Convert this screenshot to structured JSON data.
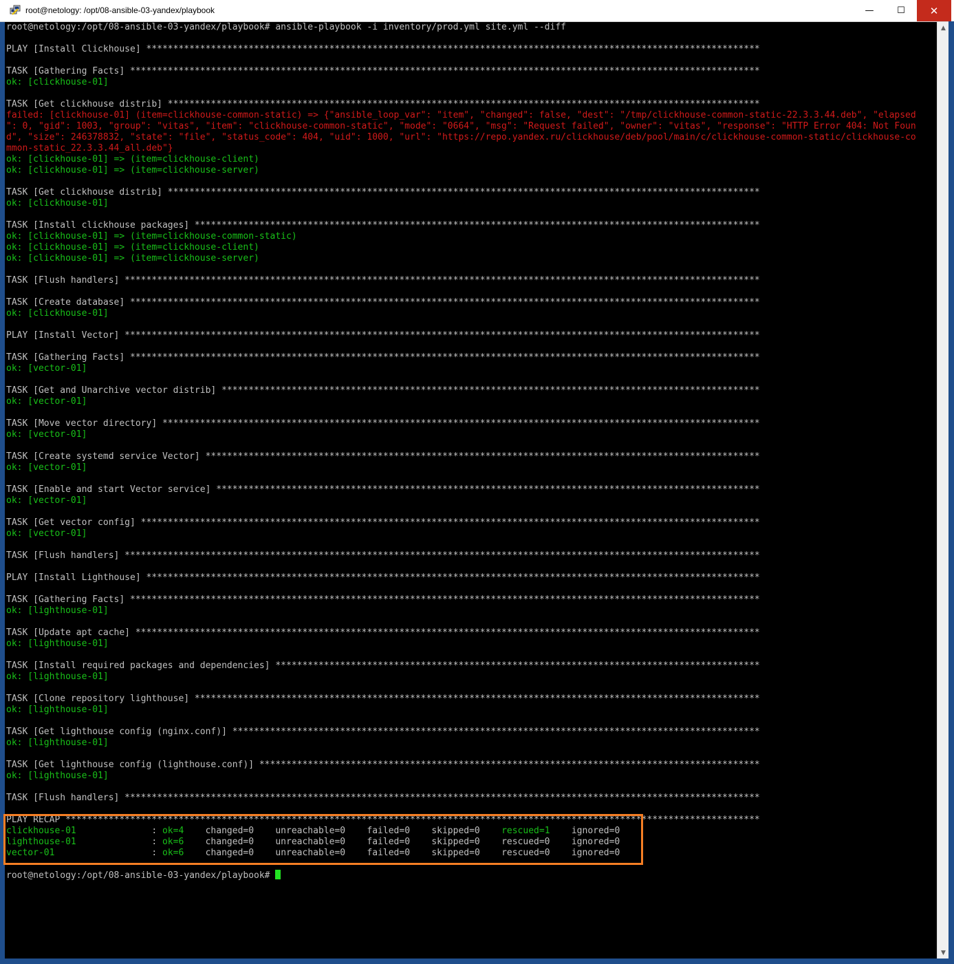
{
  "window": {
    "title": "root@netology: /opt/08-ansible-03-yandex/playbook",
    "minimize_glyph": "—",
    "maximize_glyph": "☐",
    "close_glyph": "✕"
  },
  "terminal": {
    "lines": [
      {
        "segments": [
          {
            "text": "root@netology:/opt/08-ansible-03-yandex/playbook# ansible-playbook -i inventory/prod.yml site.yml --diff",
            "color": "gray"
          }
        ]
      },
      {
        "segments": []
      },
      {
        "segments": [
          {
            "text": "PLAY [Install Clickhouse] ******************************************************************************************************************",
            "color": "gray"
          }
        ]
      },
      {
        "segments": []
      },
      {
        "segments": [
          {
            "text": "TASK [Gathering Facts] *********************************************************************************************************************",
            "color": "gray"
          }
        ]
      },
      {
        "segments": [
          {
            "text": "ok: [clickhouse-01]",
            "color": "green"
          }
        ]
      },
      {
        "segments": []
      },
      {
        "segments": [
          {
            "text": "TASK [Get clickhouse distrib] **************************************************************************************************************",
            "color": "gray"
          }
        ]
      },
      {
        "segments": [
          {
            "text": "failed: [clickhouse-01] (item=clickhouse-common-static) => {\"ansible_loop_var\": \"item\", \"changed\": false, \"dest\": \"/tmp/clickhouse-common-static-22.3.3.44.deb\", \"elapsed",
            "color": "red"
          }
        ]
      },
      {
        "segments": [
          {
            "text": "\": 0, \"gid\": 1003, \"group\": \"vitas\", \"item\": \"clickhouse-common-static\", \"mode\": \"0664\", \"msg\": \"Request failed\", \"owner\": \"vitas\", \"response\": \"HTTP Error 404: Not Foun",
            "color": "red"
          }
        ]
      },
      {
        "segments": [
          {
            "text": "d\", \"size\": 246378832, \"state\": \"file\", \"status_code\": 404, \"uid\": 1000, \"url\": \"https://repo.yandex.ru/clickhouse/deb/pool/main/c/clickhouse-common-static/clickhouse-co",
            "color": "red"
          }
        ]
      },
      {
        "segments": [
          {
            "text": "mmon-static_22.3.3.44_all.deb\"}",
            "color": "red"
          }
        ]
      },
      {
        "segments": [
          {
            "text": "ok: [clickhouse-01] => (item=clickhouse-client)",
            "color": "green"
          }
        ]
      },
      {
        "segments": [
          {
            "text": "ok: [clickhouse-01] => (item=clickhouse-server)",
            "color": "green"
          }
        ]
      },
      {
        "segments": []
      },
      {
        "segments": [
          {
            "text": "TASK [Get clickhouse distrib] **************************************************************************************************************",
            "color": "gray"
          }
        ]
      },
      {
        "segments": [
          {
            "text": "ok: [clickhouse-01]",
            "color": "green"
          }
        ]
      },
      {
        "segments": []
      },
      {
        "segments": [
          {
            "text": "TASK [Install clickhouse packages] *********************************************************************************************************",
            "color": "gray"
          }
        ]
      },
      {
        "segments": [
          {
            "text": "ok: [clickhouse-01] => (item=clickhouse-common-static)",
            "color": "green"
          }
        ]
      },
      {
        "segments": [
          {
            "text": "ok: [clickhouse-01] => (item=clickhouse-client)",
            "color": "green"
          }
        ]
      },
      {
        "segments": [
          {
            "text": "ok: [clickhouse-01] => (item=clickhouse-server)",
            "color": "green"
          }
        ]
      },
      {
        "segments": []
      },
      {
        "segments": [
          {
            "text": "TASK [Flush handlers] **********************************************************************************************************************",
            "color": "gray"
          }
        ]
      },
      {
        "segments": []
      },
      {
        "segments": [
          {
            "text": "TASK [Create database] *********************************************************************************************************************",
            "color": "gray"
          }
        ]
      },
      {
        "segments": [
          {
            "text": "ok: [clickhouse-01]",
            "color": "green"
          }
        ]
      },
      {
        "segments": []
      },
      {
        "segments": [
          {
            "text": "PLAY [Install Vector] **********************************************************************************************************************",
            "color": "gray"
          }
        ]
      },
      {
        "segments": []
      },
      {
        "segments": [
          {
            "text": "TASK [Gathering Facts] *********************************************************************************************************************",
            "color": "gray"
          }
        ]
      },
      {
        "segments": [
          {
            "text": "ok: [vector-01]",
            "color": "green"
          }
        ]
      },
      {
        "segments": []
      },
      {
        "segments": [
          {
            "text": "TASK [Get and Unarchive vector distrib] ****************************************************************************************************",
            "color": "gray"
          }
        ]
      },
      {
        "segments": [
          {
            "text": "ok: [vector-01]",
            "color": "green"
          }
        ]
      },
      {
        "segments": []
      },
      {
        "segments": [
          {
            "text": "TASK [Move vector directory] ***************************************************************************************************************",
            "color": "gray"
          }
        ]
      },
      {
        "segments": [
          {
            "text": "ok: [vector-01]",
            "color": "green"
          }
        ]
      },
      {
        "segments": []
      },
      {
        "segments": [
          {
            "text": "TASK [Create systemd service Vector] *******************************************************************************************************",
            "color": "gray"
          }
        ]
      },
      {
        "segments": [
          {
            "text": "ok: [vector-01]",
            "color": "green"
          }
        ]
      },
      {
        "segments": []
      },
      {
        "segments": [
          {
            "text": "TASK [Enable and start Vector service] *****************************************************************************************************",
            "color": "gray"
          }
        ]
      },
      {
        "segments": [
          {
            "text": "ok: [vector-01]",
            "color": "green"
          }
        ]
      },
      {
        "segments": []
      },
      {
        "segments": [
          {
            "text": "TASK [Get vector config] *******************************************************************************************************************",
            "color": "gray"
          }
        ]
      },
      {
        "segments": [
          {
            "text": "ok: [vector-01]",
            "color": "green"
          }
        ]
      },
      {
        "segments": []
      },
      {
        "segments": [
          {
            "text": "TASK [Flush handlers] **********************************************************************************************************************",
            "color": "gray"
          }
        ]
      },
      {
        "segments": []
      },
      {
        "segments": [
          {
            "text": "PLAY [Install Lighthouse] ******************************************************************************************************************",
            "color": "gray"
          }
        ]
      },
      {
        "segments": []
      },
      {
        "segments": [
          {
            "text": "TASK [Gathering Facts] *********************************************************************************************************************",
            "color": "gray"
          }
        ]
      },
      {
        "segments": [
          {
            "text": "ok: [lighthouse-01]",
            "color": "green"
          }
        ]
      },
      {
        "segments": []
      },
      {
        "segments": [
          {
            "text": "TASK [Update apt cache] ********************************************************************************************************************",
            "color": "gray"
          }
        ]
      },
      {
        "segments": [
          {
            "text": "ok: [lighthouse-01]",
            "color": "green"
          }
        ]
      },
      {
        "segments": []
      },
      {
        "segments": [
          {
            "text": "TASK [Install required packages and dependencies] ******************************************************************************************",
            "color": "gray"
          }
        ]
      },
      {
        "segments": [
          {
            "text": "ok: [lighthouse-01]",
            "color": "green"
          }
        ]
      },
      {
        "segments": []
      },
      {
        "segments": [
          {
            "text": "TASK [Clone repository lighthouse] *********************************************************************************************************",
            "color": "gray"
          }
        ]
      },
      {
        "segments": [
          {
            "text": "ok: [lighthouse-01]",
            "color": "green"
          }
        ]
      },
      {
        "segments": []
      },
      {
        "segments": [
          {
            "text": "TASK [Get lighthouse config (nginx.conf)] **************************************************************************************************",
            "color": "gray"
          }
        ]
      },
      {
        "segments": [
          {
            "text": "ok: [lighthouse-01]",
            "color": "green"
          }
        ]
      },
      {
        "segments": []
      },
      {
        "segments": [
          {
            "text": "TASK [Get lighthouse config (lighthouse.conf)] *********************************************************************************************",
            "color": "gray"
          }
        ]
      },
      {
        "segments": [
          {
            "text": "ok: [lighthouse-01]",
            "color": "green"
          }
        ]
      },
      {
        "segments": []
      },
      {
        "segments": [
          {
            "text": "TASK [Flush handlers] **********************************************************************************************************************",
            "color": "gray"
          }
        ]
      },
      {
        "segments": []
      },
      {
        "segments": [
          {
            "text": "PLAY RECAP *********************************************************************************************************************************",
            "color": "gray"
          }
        ]
      },
      {
        "segments": [
          {
            "text": "clickhouse-01",
            "color": "green"
          },
          {
            "text": "              : ",
            "color": "gray"
          },
          {
            "text": "ok=4",
            "color": "green"
          },
          {
            "text": "    changed=0    unreachable=0    failed=0    skipped=0    ",
            "color": "gray"
          },
          {
            "text": "rescued=1",
            "color": "green"
          },
          {
            "text": "    ignored=0",
            "color": "gray"
          }
        ]
      },
      {
        "segments": [
          {
            "text": "lighthouse-01",
            "color": "green"
          },
          {
            "text": "              : ",
            "color": "gray"
          },
          {
            "text": "ok=6",
            "color": "green"
          },
          {
            "text": "    changed=0    unreachable=0    failed=0    skipped=0    rescued=0    ignored=0",
            "color": "gray"
          }
        ]
      },
      {
        "segments": [
          {
            "text": "vector-01",
            "color": "green"
          },
          {
            "text": "                  : ",
            "color": "gray"
          },
          {
            "text": "ok=6",
            "color": "green"
          },
          {
            "text": "    changed=0    unreachable=0    failed=0    skipped=0    rescued=0    ignored=0",
            "color": "gray"
          }
        ]
      },
      {
        "segments": []
      },
      {
        "segments": [
          {
            "text": "root@netology:/opt/08-ansible-03-yandex/playbook# ",
            "color": "gray"
          }
        ],
        "cursor": true
      }
    ]
  },
  "highlight": {
    "color": "#f57e24",
    "label": "PLAY RECAP"
  },
  "colors": {
    "gray": "#c0c0c0",
    "green": "#19c019",
    "red": "#d11a1a",
    "cursor": "#22e322",
    "titlebar_close": "#c42b1c"
  },
  "scrollbar": {
    "up_arrow": "▲",
    "down_arrow": "▼"
  }
}
